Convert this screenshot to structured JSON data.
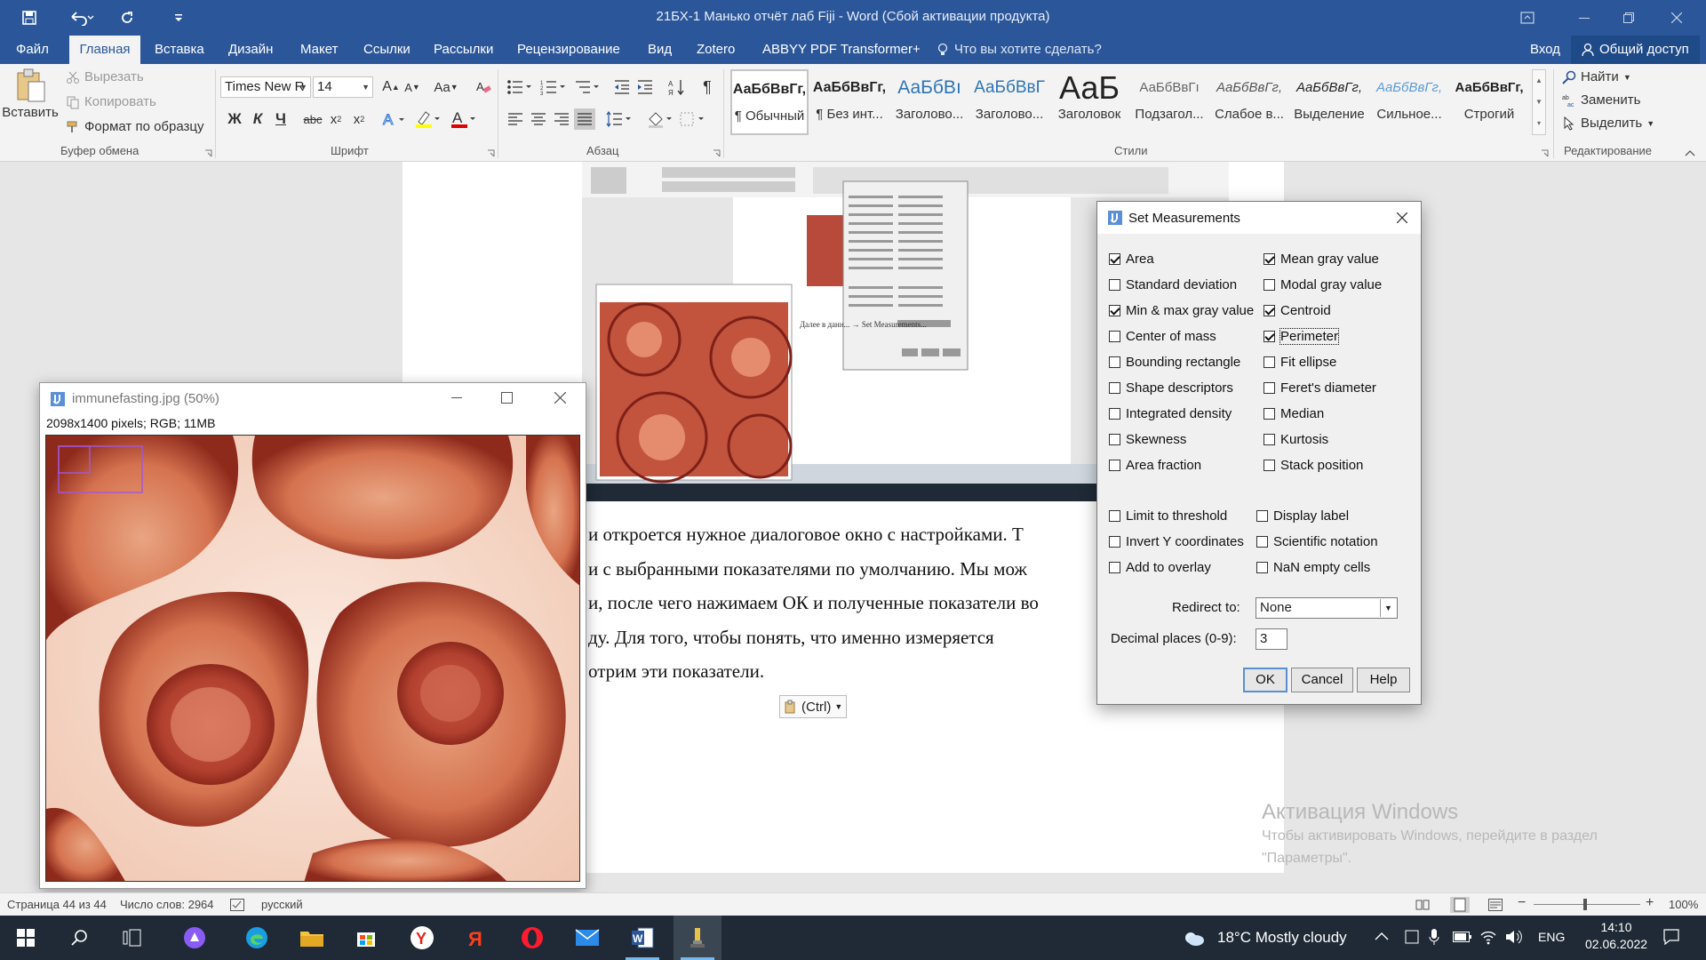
{
  "titlebar": {
    "document_title": "21БХ-1 Манько отчёт лаб Fiji  -  Word (Сбой активации продукта)"
  },
  "tabs": [
    "Файл",
    "Главная",
    "Вставка",
    "Дизайн",
    "Макет",
    "Ссылки",
    "Рассылки",
    "Рецензирование",
    "Вид",
    "Zotero",
    "ABBYY PDF Transformer+"
  ],
  "active_tab": "Главная",
  "tell_me": "Что вы хотите сделать?",
  "account": {
    "signin": "Вход",
    "share": "Общий доступ"
  },
  "ribbon": {
    "clipboard": {
      "paste": "Вставить",
      "cut": "Вырезать",
      "copy": "Копировать",
      "format_painter": "Формат по образцу",
      "label": "Буфер обмена"
    },
    "font": {
      "name": "Times New R",
      "size": "14",
      "label": "Шрифт",
      "change_case": "Aa"
    },
    "paragraph": {
      "label": "Абзац"
    },
    "styles": {
      "label": "Стили",
      "items": [
        {
          "sample": "АаБбВвГг,",
          "name": "¶ Обычный"
        },
        {
          "sample": "АаБбВвГг,",
          "name": "¶ Без инт..."
        },
        {
          "sample": "АаБбВı",
          "name": "Заголово..."
        },
        {
          "sample": "АаБбВвГ",
          "name": "Заголово..."
        },
        {
          "sample": "АаБ",
          "name": "Заголовок"
        },
        {
          "sample": "АаБбВвГı",
          "name": "Подзагол..."
        },
        {
          "sample": "АаБбВвГг,",
          "name": "Слабое в..."
        },
        {
          "sample": "АаБбВвГг,",
          "name": "Выделение"
        },
        {
          "sample": "АаБбВвГг,",
          "name": "Сильное..."
        },
        {
          "sample": "АаБбВвГг,",
          "name": "Строгий"
        }
      ]
    },
    "editing": {
      "find": "Найти",
      "replace": "Заменить",
      "select": "Выделить",
      "label": "Редактирование"
    }
  },
  "document": {
    "lines": [
      "и откроется нужное диалоговое окно с настройками. Т",
      "и с выбранными показателями по умолчанию. Мы мож",
      "и, после чего нажимаем ОК и полученные показатели во",
      "ду. Для того, чтобы понять, что именно измеряется",
      "отрим эти показатели."
    ],
    "paste_options": "(Ctrl)",
    "embedded_caption": "Далее в данн... → Set Measurements..."
  },
  "image_window": {
    "title": "immunefasting.jpg (50%)",
    "info": "2098x1400 pixels; RGB; 11MB"
  },
  "dialog": {
    "title": "Set Measurements",
    "left_checks": [
      {
        "label": "Area",
        "checked": true
      },
      {
        "label": "Standard deviation",
        "checked": false
      },
      {
        "label": "Min & max gray value",
        "checked": true
      },
      {
        "label": "Center of mass",
        "checked": false
      },
      {
        "label": "Bounding rectangle",
        "checked": false
      },
      {
        "label": "Shape descriptors",
        "checked": false
      },
      {
        "label": "Integrated density",
        "checked": false
      },
      {
        "label": "Skewness",
        "checked": false
      },
      {
        "label": "Area fraction",
        "checked": false
      }
    ],
    "right_checks": [
      {
        "label": "Mean gray value",
        "checked": true
      },
      {
        "label": "Modal gray value",
        "checked": false
      },
      {
        "label": "Centroid",
        "checked": true
      },
      {
        "label": "Perimeter",
        "checked": true
      },
      {
        "label": "Fit ellipse",
        "checked": false
      },
      {
        "label": "Feret's diameter",
        "checked": false
      },
      {
        "label": "Median",
        "checked": false
      },
      {
        "label": "Kurtosis",
        "checked": false
      },
      {
        "label": "Stack position",
        "checked": false
      }
    ],
    "left_checks2": [
      {
        "label": "Limit to threshold",
        "checked": false
      },
      {
        "label": "Invert Y coordinates",
        "checked": false
      },
      {
        "label": "Add to overlay",
        "checked": false
      }
    ],
    "right_checks2": [
      {
        "label": "Display label",
        "checked": false
      },
      {
        "label": "Scientific notation",
        "checked": false
      },
      {
        "label": "NaN empty cells",
        "checked": false
      }
    ],
    "redirect_label": "Redirect to:",
    "redirect_value": "None",
    "decimal_label": "Decimal places (0-9):",
    "decimal_value": "3",
    "ok": "OK",
    "cancel": "Cancel",
    "help": "Help"
  },
  "statusbar": {
    "page": "Страница 44 из 44",
    "words": "Число слов: 2964",
    "language": "русский",
    "zoom": "100%"
  },
  "watermark": {
    "title": "Активация Windows",
    "line1": "Чтобы активировать Windows, перейдите в раздел",
    "line2": "\"Параметры\"."
  },
  "taskbar": {
    "weather": "18°C  Mostly cloudy",
    "lang": "ENG",
    "time": "14:10",
    "date": "02.06.2022"
  },
  "colors": {
    "word_blue": "#2b579a",
    "taskbar": "#1f2a36"
  }
}
